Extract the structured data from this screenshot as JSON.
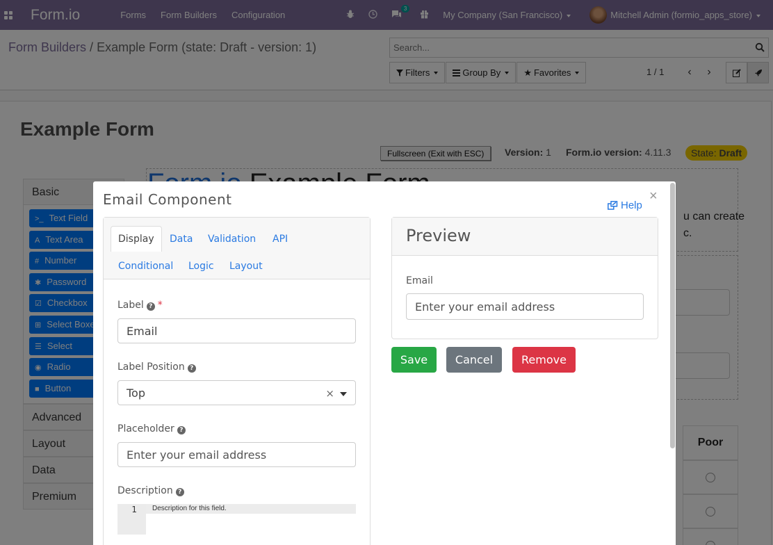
{
  "navbar": {
    "brand": "Form.io",
    "menu": [
      "Forms",
      "Form Builders",
      "Configuration"
    ],
    "messages_count": "3",
    "company": "My Company (San Francisco)",
    "user": "Mitchell Admin (formio_apps_store)",
    "bg_color": "#7c6d9a"
  },
  "breadcrumb": {
    "parent": "Form Builders",
    "separator": "/",
    "current": "Example Form (state: Draft - version: 1)"
  },
  "search": {
    "placeholder": "Search..."
  },
  "filters": {
    "filters_label": "Filters",
    "group_by_label": "Group By",
    "favorites_label": "Favorites"
  },
  "pager": {
    "value": "1 / 1"
  },
  "sheet": {
    "title": "Example Form",
    "fullscreen_label": "Fullscreen (Exit with ESC)",
    "version_label": "Version:",
    "version_value": "1",
    "formio_version_label": "Form.io version:",
    "formio_version_value": "4.11.3",
    "state_label": "State:",
    "state_value": "Draft",
    "state_color": "#f3cc00"
  },
  "builder": {
    "groups": [
      "Basic",
      "Advanced",
      "Layout",
      "Data",
      "Premium"
    ],
    "basic_components": [
      {
        "icon": ">_",
        "label": "Text Field"
      },
      {
        "icon": "A",
        "label": "Text Area"
      },
      {
        "icon": "#",
        "label": "Number"
      },
      {
        "icon": "✱",
        "label": "Password"
      },
      {
        "icon": "☑",
        "label": "Checkbox"
      },
      {
        "icon": "⊞",
        "label": "Select Boxes"
      },
      {
        "icon": "☰",
        "label": "Select"
      },
      {
        "icon": "◉",
        "label": "Radio"
      },
      {
        "icon": "■",
        "label": "Button"
      }
    ],
    "canvas_title_blue": "Form.io",
    "canvas_title_rest": " Example Form",
    "canvas_text_line1": "u can create",
    "canvas_text_line2": "c.",
    "survey_header": "Poor"
  },
  "modal": {
    "title": "Email Component",
    "help_label": "Help",
    "tabs": [
      "Display",
      "Data",
      "Validation",
      "API",
      "Conditional",
      "Logic",
      "Layout"
    ],
    "active_tab": "Display",
    "label_label": "Label",
    "label_value": "Email",
    "label_position_label": "Label Position",
    "label_position_value": "Top",
    "placeholder_label": "Placeholder",
    "placeholder_value": "Enter your email address",
    "description_label": "Description",
    "description_line_number": "1",
    "description_placeholder": "Description for this field.",
    "preview_title": "Preview",
    "preview_field_label": "Email",
    "preview_field_placeholder": "Enter your email address",
    "save_label": "Save",
    "cancel_label": "Cancel",
    "remove_label": "Remove",
    "save_color": "#28a745",
    "cancel_color": "#6c757d",
    "remove_color": "#dc3545"
  }
}
